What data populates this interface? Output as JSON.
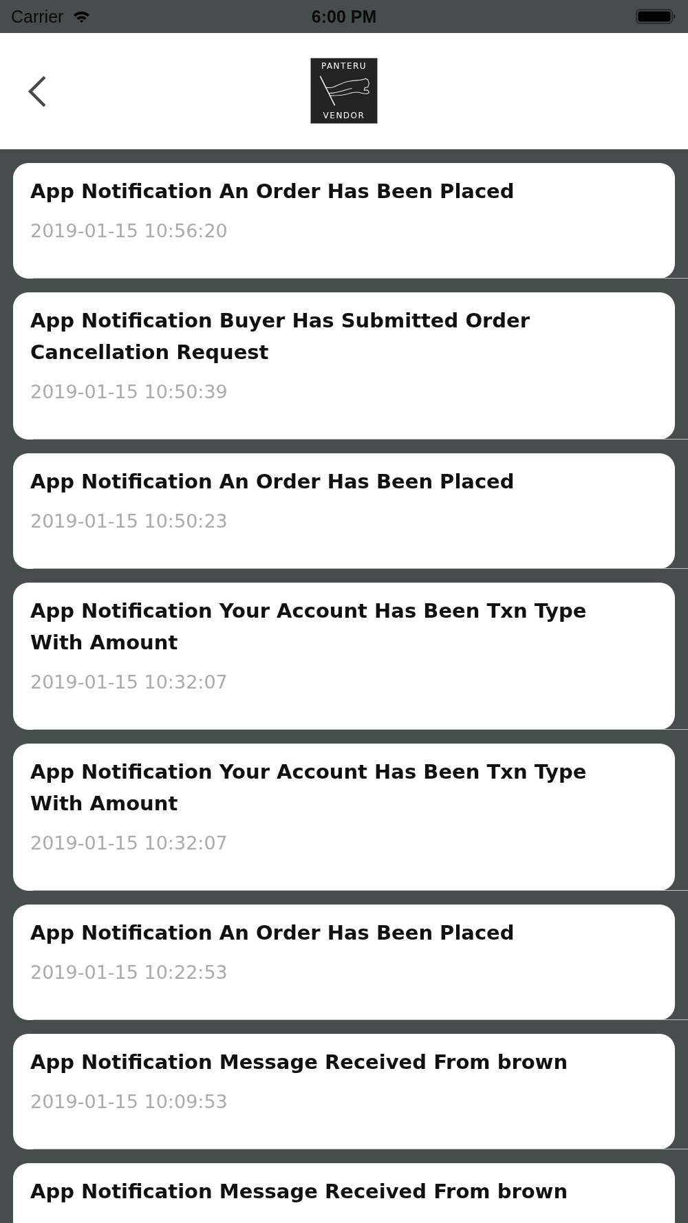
{
  "status_bar": {
    "carrier": "Carrier",
    "time": "6:00 PM"
  },
  "header": {
    "logo": {
      "top_text": "PANTERU",
      "bottom_text": "VENDOR"
    }
  },
  "notifications": [
    {
      "title": "App Notification An Order Has Been Placed",
      "timestamp": "2019-01-15 10:56:20"
    },
    {
      "title": "App Notification Buyer Has Submitted Order Cancellation Request",
      "timestamp": "2019-01-15 10:50:39"
    },
    {
      "title": "App Notification An Order Has Been Placed",
      "timestamp": "2019-01-15 10:50:23"
    },
    {
      "title": "App Notification Your Account Has Been Txn Type With Amount",
      "timestamp": "2019-01-15 10:32:07"
    },
    {
      "title": "App Notification Your Account Has Been Txn Type With Amount",
      "timestamp": "2019-01-15 10:32:07"
    },
    {
      "title": "App Notification An Order Has Been Placed",
      "timestamp": "2019-01-15 10:22:53"
    },
    {
      "title": "App Notification Message Received From brown",
      "timestamp": "2019-01-15 10:09:53"
    },
    {
      "title": "App Notification Message Received From brown"
    }
  ]
}
